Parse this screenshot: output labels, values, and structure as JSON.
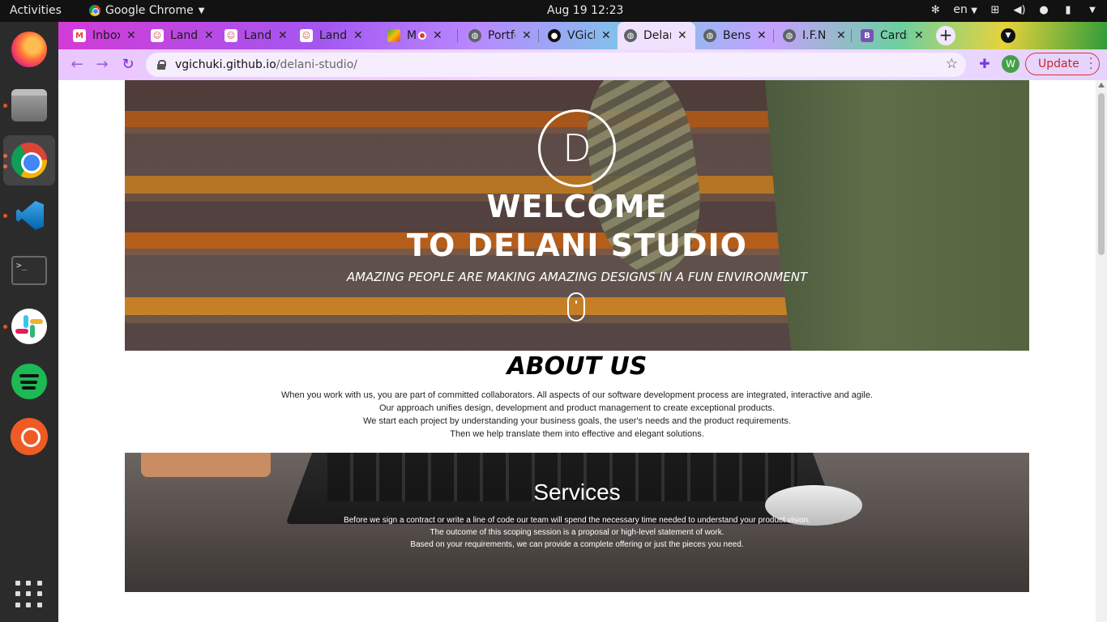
{
  "topbar": {
    "activities": "Activities",
    "app_name": "Google Chrome",
    "clock": "Aug 19  12:23",
    "lang": "en"
  },
  "dock": {
    "items": [
      "firefox",
      "files",
      "google-chrome",
      "vscode",
      "terminal",
      "slack",
      "spotify",
      "postman",
      "show-applications"
    ]
  },
  "tabs": [
    {
      "title": "Inbox",
      "favicon": "gmail-icon",
      "color": "#ea4335"
    },
    {
      "title": "Landing",
      "favicon": "avatar-icon",
      "color": "#d94545"
    },
    {
      "title": "Landing",
      "favicon": "avatar-icon",
      "color": "#d94545"
    },
    {
      "title": "Landing",
      "favicon": "avatar-icon",
      "color": "#d94545"
    },
    {
      "title": "M",
      "favicon": "meet-icon",
      "color": "#34a853"
    },
    {
      "title": "Portfolio",
      "favicon": "globe-icon",
      "color": "#5f6368"
    },
    {
      "title": "VGichuki",
      "favicon": "github-icon",
      "color": "#111111"
    },
    {
      "title": "Delani",
      "favicon": "globe-icon",
      "color": "#5f6368"
    },
    {
      "title": "Bens",
      "favicon": "globe-icon",
      "color": "#5f6368"
    },
    {
      "title": "I.F.N",
      "favicon": "globe-icon",
      "color": "#5f6368"
    },
    {
      "title": "Cards",
      "favicon": "bootstrap-icon",
      "color": "#7952b3"
    }
  ],
  "toolbar": {
    "url_host": "vgichuki.github.io",
    "url_path": "/delani-studio/",
    "profile_initial": "W",
    "update_label": "Update"
  },
  "hero": {
    "logo_letter": "D",
    "title_line1": "WELCOME",
    "title_line2": "TO DELANI STUDIO",
    "subtitle": "AMAZING PEOPLE ARE MAKING AMAZING DESIGNS IN A FUN ENVIRONMENT"
  },
  "about": {
    "title": "ABOUT US",
    "lines": [
      "When you work with us, you are part of committed collaborators. All aspects of our software development process are integrated, interactive and agile.",
      "Our approach unifies design, development and product management to create exceptional products.",
      "We start each project by understanding your business goals, the user's needs and the product requirements.",
      "Then we help translate them into effective and elegant solutions."
    ]
  },
  "services": {
    "title": "Services",
    "lines": [
      "Before we sign a contract or write a line of code our team will spend the necessary time needed to understand your product vision.",
      "The outcome of this scoping session is a proposal or high-level statement of work.",
      "Based on your requirements, we can provide a complete offering or just the pieces you need."
    ]
  }
}
